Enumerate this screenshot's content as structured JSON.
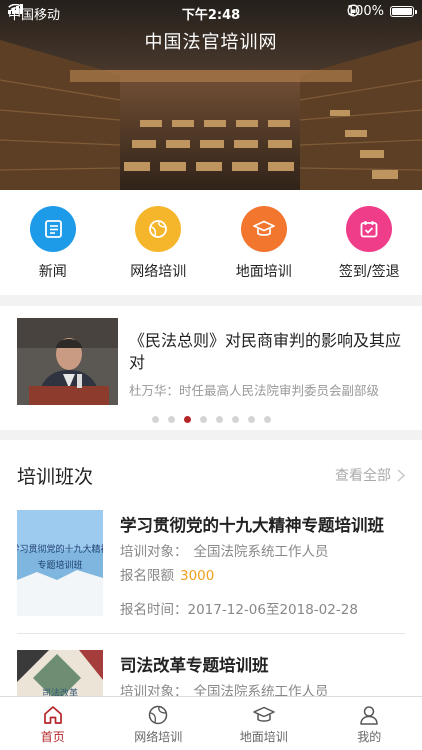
{
  "status_bar": {
    "carrier": "中国移动",
    "time": "下午2:48",
    "battery": "100%"
  },
  "app_title": "中国法官培训网",
  "menu": [
    {
      "label": "新闻",
      "icon": "news-icon",
      "color": "#1e9be8"
    },
    {
      "label": "网络培训",
      "icon": "globe-icon",
      "color": "#f6b62c"
    },
    {
      "label": "地面培训",
      "icon": "graduation-cap-icon",
      "color": "#f2762e"
    },
    {
      "label": "签到/签退",
      "icon": "calendar-check-icon",
      "color": "#ef3d8a"
    }
  ],
  "news": {
    "title": "《民法总则》对民商审判的影响及其应对",
    "subtitle": "杜万华：时任最高人民法院审判委员会副部级",
    "slide_count": 8,
    "active_slide": 3
  },
  "courses_section": {
    "title": "培训班次",
    "view_all": "查看全部",
    "items": [
      {
        "title": "学习贯彻党的十九大精神专题培训班",
        "thumb_text": [
          "学习贯彻党的十九大精神",
          "专题培训班"
        ],
        "target_label": "培训对象：",
        "target_value": "全国法院系统工作人员",
        "quota_label": "报名限额",
        "quota_value": "3000",
        "time_label": "报名时间：",
        "time_value": "2017-12-06至2018-02-28"
      },
      {
        "title": "司法改革专题培训班",
        "thumb_text": [
          "司法改革"
        ],
        "target_label": "培训对象：",
        "target_value": "全国法院系统工作人员"
      }
    ]
  },
  "tabbar": [
    {
      "label": "首页",
      "icon": "home-icon",
      "active": true
    },
    {
      "label": "网络培训",
      "icon": "globe-icon",
      "active": false
    },
    {
      "label": "地面培训",
      "icon": "graduation-cap-icon",
      "active": false
    },
    {
      "label": "我的",
      "icon": "user-icon",
      "active": false
    }
  ],
  "colors": {
    "accent": "#b5262a",
    "quota": "#f0a020",
    "muted": "#888888"
  }
}
